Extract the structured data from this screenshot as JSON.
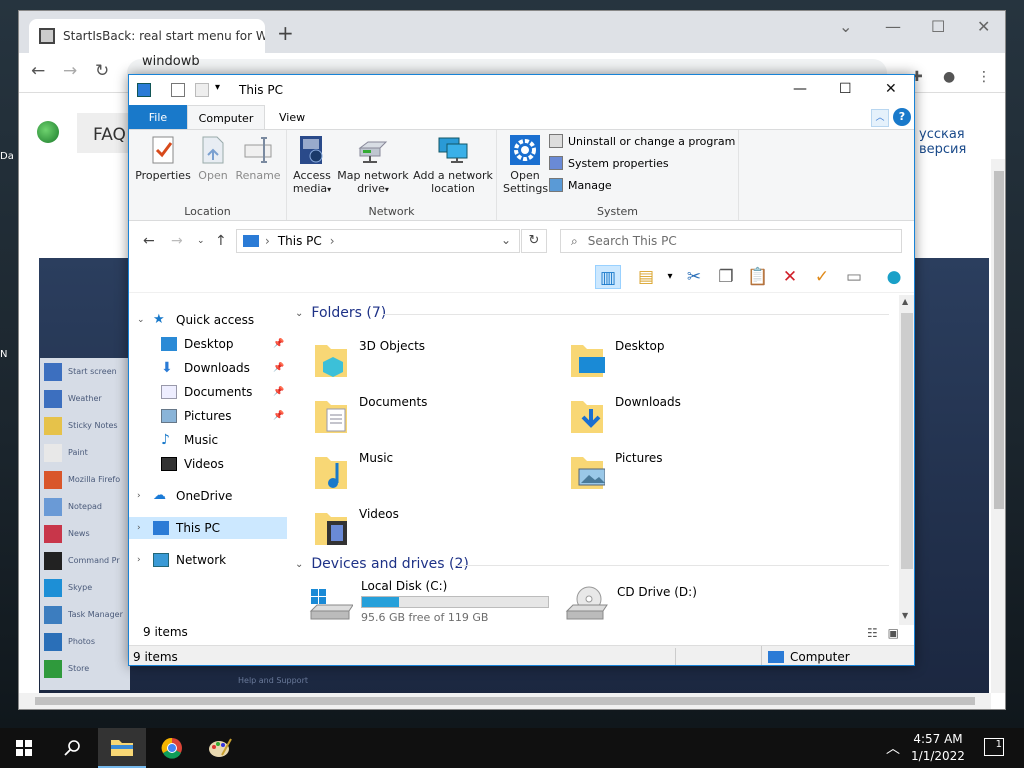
{
  "browser": {
    "tab_title": "StartIsBack: real start menu for W",
    "tab_close": "✕",
    "new_tab": "+",
    "omnibox_text": "windowb",
    "page": {
      "faq_label": "FAQ",
      "russian_link": "усская версия",
      "start_menu_items": [
        "Start screen",
        "Weather",
        "Sticky Notes",
        "Paint",
        "Mozilla Firefo",
        "Notepad",
        "News",
        "Command Pr",
        "Skype",
        "Task Manager",
        "Photos",
        "Store"
      ],
      "help_text": "Help and Support"
    }
  },
  "desktop": {
    "labels": [
      "Da",
      "N"
    ]
  },
  "explorer": {
    "title": "This PC",
    "tabs": {
      "file": "File",
      "computer": "Computer",
      "view": "View"
    },
    "ribbon": {
      "location_group": "Location",
      "network_group": "Network",
      "system_group": "System",
      "properties": "Properties",
      "open": "Open",
      "rename": "Rename",
      "access_media": "Access media",
      "map_drive": "Map network drive",
      "add_location": "Add a network location",
      "open_settings": "Open Settings",
      "uninstall": "Uninstall or change a program",
      "system_properties": "System properties",
      "manage": "Manage"
    },
    "address": {
      "path": "This PC",
      "search_placeholder": "Search This PC"
    },
    "nav": {
      "quick_access": "Quick access",
      "desktop": "Desktop",
      "downloads": "Downloads",
      "documents": "Documents",
      "pictures": "Pictures",
      "music": "Music",
      "videos": "Videos",
      "onedrive": "OneDrive",
      "this_pc": "This PC",
      "network": "Network"
    },
    "folders_header": "Folders (7)",
    "folders": [
      "3D Objects",
      "Desktop",
      "Documents",
      "Downloads",
      "Music",
      "Pictures",
      "Videos"
    ],
    "devices_header": "Devices and drives (2)",
    "drives": {
      "c_name": "Local Disk (C:)",
      "c_free": "95.6 GB free of 119 GB",
      "c_used_fraction": 0.2,
      "d_name": "CD Drive (D:)"
    },
    "item_count_inner": "9 items",
    "status_left": "9 items",
    "status_right": "Computer"
  },
  "taskbar": {
    "time": "4:57 AM",
    "date": "1/1/2022",
    "notifications": "1"
  },
  "colors": {
    "accent": "#1979ca",
    "selected": "#cce8ff",
    "folder": "#f8d775",
    "drive_bar": "#26a0da"
  }
}
